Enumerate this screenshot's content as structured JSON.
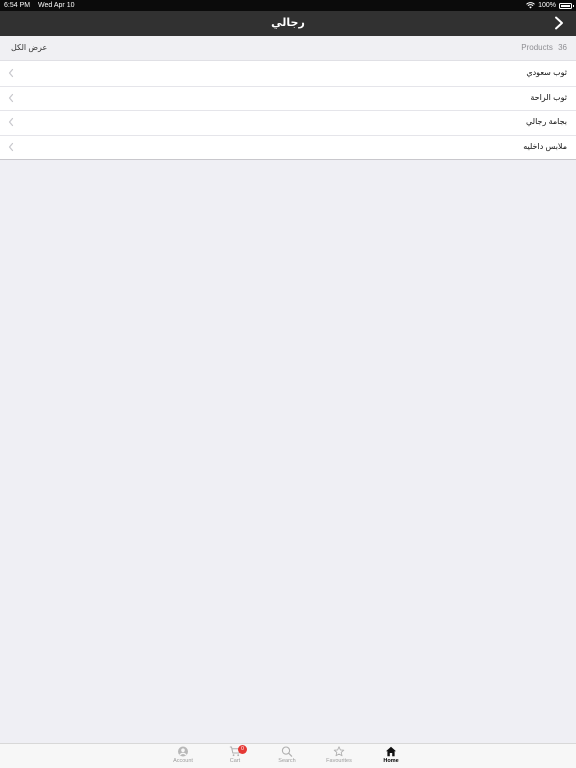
{
  "status_bar": {
    "time": "6:54 PM",
    "date": "Wed Apr 10",
    "battery": "100%"
  },
  "nav": {
    "title": "رجالي",
    "back_icon": "chevron-right-icon"
  },
  "header": {
    "view_all": "عرض الكل",
    "products_count": "36",
    "products_label": "Products"
  },
  "categories": [
    {
      "label": "ثوب سعودي"
    },
    {
      "label": "ثوب الراحة"
    },
    {
      "label": "بجامة رجالي"
    },
    {
      "label": "ملابس داخليه"
    }
  ],
  "tab_bar": {
    "tabs": [
      {
        "label": "Account",
        "icon": "account-icon"
      },
      {
        "label": "Cart",
        "icon": "cart-icon",
        "badge": "0"
      },
      {
        "label": "Search",
        "icon": "search-icon"
      },
      {
        "label": "Favourites",
        "icon": "star-icon"
      },
      {
        "label": "Home",
        "icon": "home-icon",
        "active": true
      }
    ]
  },
  "colors": {
    "nav_background": "#313131",
    "page_background": "#efeff4",
    "badge": "#e53935"
  }
}
